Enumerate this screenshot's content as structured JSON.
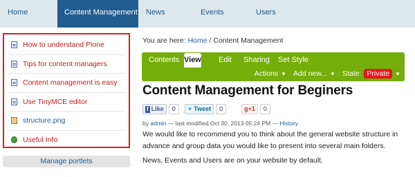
{
  "topnav": {
    "items": [
      "Home",
      "Content Management",
      "News",
      "Events",
      "Users"
    ],
    "active": "Content Management"
  },
  "portlet": {
    "items": [
      {
        "label": "How to understand Plone",
        "icon": "document-icon"
      },
      {
        "label": "Tips for content managers",
        "icon": "document-icon"
      },
      {
        "label": "Content management is easy",
        "icon": "document-icon"
      },
      {
        "label": "Use TinyMCE editor",
        "icon": "document-icon"
      },
      {
        "label": "structure.png",
        "icon": "image-icon"
      },
      {
        "label": "Useful Info",
        "icon": "link-icon"
      }
    ],
    "border_color": "#e8161e"
  },
  "manage_portlets": "Manage portlets",
  "breadcrumb": {
    "prefix": "You are here:",
    "home": "Home",
    "separator": "/",
    "current": "Content Management"
  },
  "editbar": {
    "tabs": [
      "Contents",
      "View",
      "Edit",
      "Sharing",
      "Set Style"
    ],
    "active_tab": "View",
    "actions_label": "Actions",
    "addnew_label": "Add new...",
    "state_label": "State:",
    "state_value": "Private",
    "color": "#75ad0a"
  },
  "title": "Content Management for Beginers",
  "social": {
    "like_label": "Like",
    "like_count": "0",
    "tweet_label": "Tweet",
    "tweet_count": "0",
    "gplus_label": "+1",
    "gplus_count": "0"
  },
  "byline": {
    "by": "by",
    "author": "admin",
    "modified": "— last modified Oct 30, 2013 05:24 PM —",
    "history": "History"
  },
  "body": {
    "paragraph1": "We would like to recommend you to think about the general website structure in advance and group data you would like to present into several main folders.",
    "paragraph2": "News, Events and Users are on your website by default."
  }
}
